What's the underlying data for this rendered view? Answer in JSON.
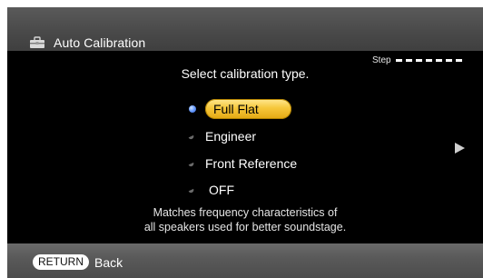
{
  "header": {
    "title": "Auto Calibration",
    "icon": "toolbox-icon"
  },
  "step": {
    "label": "Step",
    "total_dashes": 7
  },
  "prompt": "Select calibration type.",
  "options": [
    {
      "label": "Full Flat",
      "selected": true
    },
    {
      "label": "Engineer",
      "selected": false
    },
    {
      "label": "Front Reference",
      "selected": false
    },
    {
      "label": "OFF",
      "selected": false
    }
  ],
  "description": {
    "line1": "Matches frequency characteristics of",
    "line2": "all speakers used for better soundstage."
  },
  "footer": {
    "return_key": "RETURN",
    "back_label": "Back"
  },
  "colors": {
    "highlight": "#f6c73b",
    "background": "#000000",
    "bar": "#4a4a4a"
  }
}
